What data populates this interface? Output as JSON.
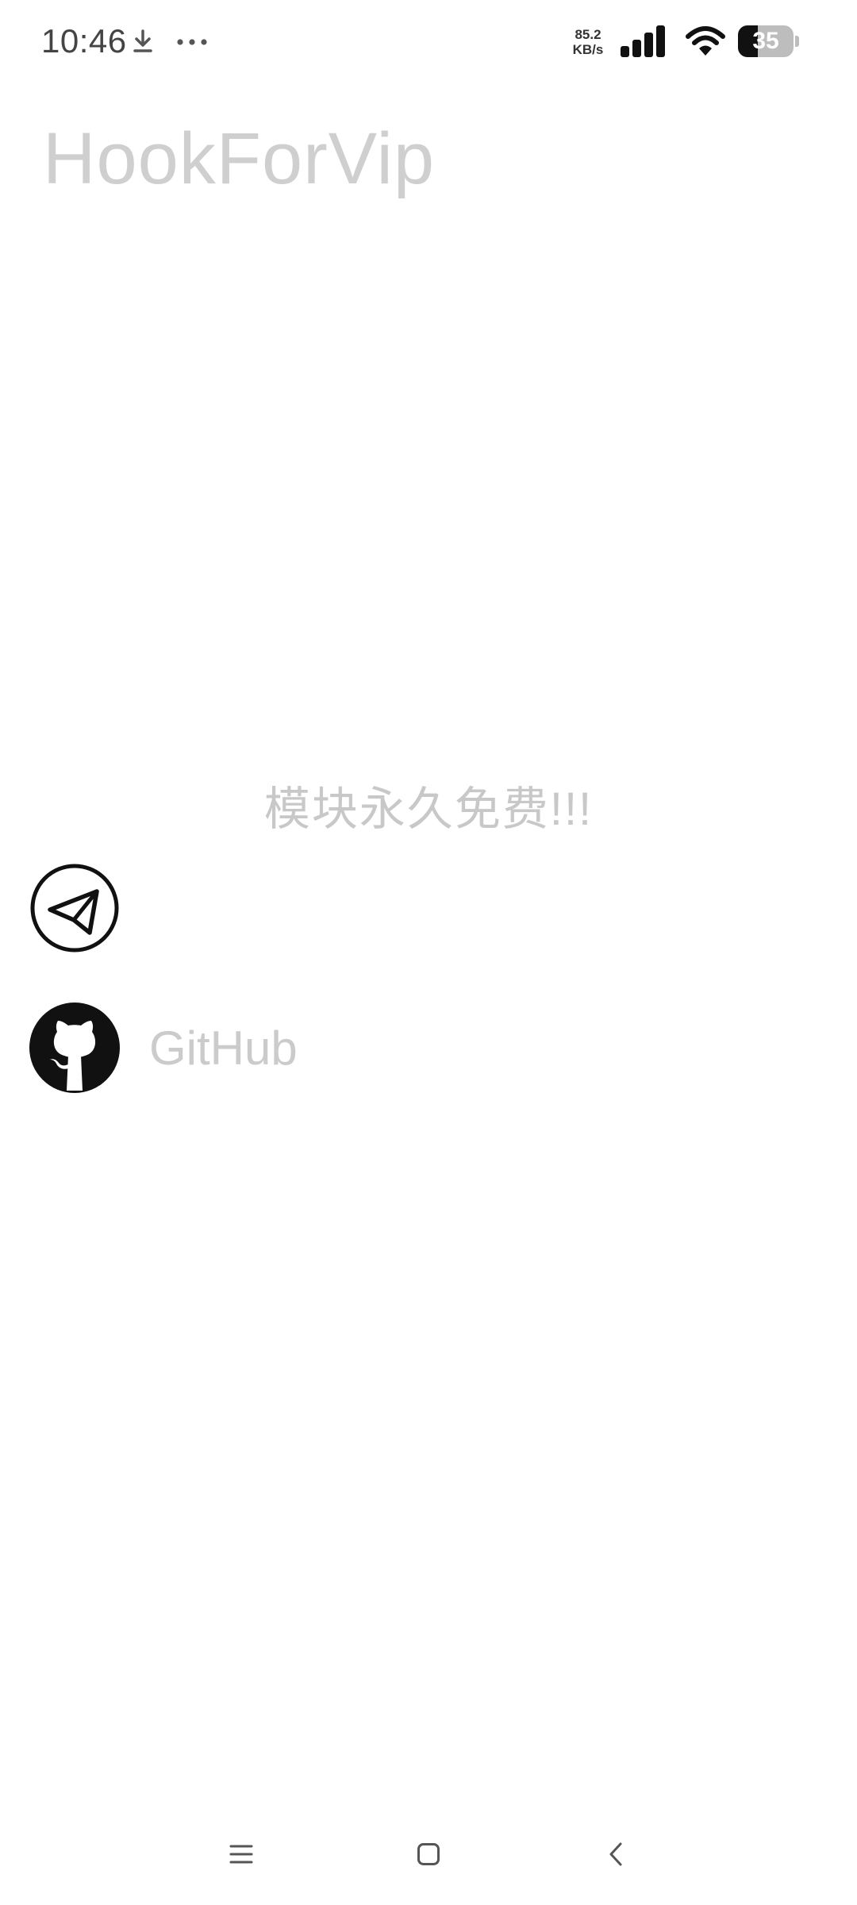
{
  "status_bar": {
    "time": "10:46",
    "net_speed_value": "85.2",
    "net_speed_unit": "KB/s",
    "battery_level": "35",
    "battery_fraction": 0.35,
    "icons": [
      "download-icon",
      "more-icon",
      "signal-icon",
      "wifi-icon",
      "battery-icon"
    ]
  },
  "app": {
    "title": "HookForVip",
    "banner": "模块永久免费!!!",
    "links": {
      "telegram": {
        "icon": "telegram-icon",
        "label": ""
      },
      "github": {
        "icon": "github-icon",
        "label": "GitHub"
      }
    }
  },
  "nav_bar": {
    "icons": [
      "menu-icon",
      "home-icon",
      "back-icon"
    ]
  },
  "colors": {
    "title_text": "#cfcfcf",
    "banner_text": "#c8c8c8",
    "link_text": "#cbcbcb",
    "icon_dark": "#111111",
    "background": "#ffffff"
  }
}
